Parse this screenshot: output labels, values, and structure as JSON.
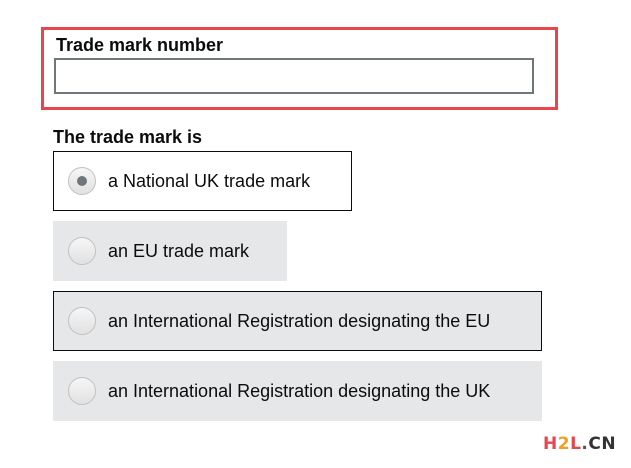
{
  "trade_mark_number": {
    "label": "Trade mark number",
    "value": "",
    "placeholder": ""
  },
  "trade_mark_type": {
    "label": "The trade mark is",
    "options": [
      {
        "label": "a National UK trade mark",
        "selected": true
      },
      {
        "label": "an EU trade mark",
        "selected": false
      },
      {
        "label": "an International Registration designating the EU",
        "selected": false
      },
      {
        "label": "an International Registration designating the UK",
        "selected": false
      }
    ]
  },
  "watermark": {
    "h": "H",
    "two": "2",
    "l": "L",
    "dot": ".",
    "cn": "CN"
  },
  "colors": {
    "error_border": "#e8464d",
    "option_background": "#e6e7e8",
    "text": "#0b0c0c",
    "radio_selected_dot": "#6f777b"
  }
}
